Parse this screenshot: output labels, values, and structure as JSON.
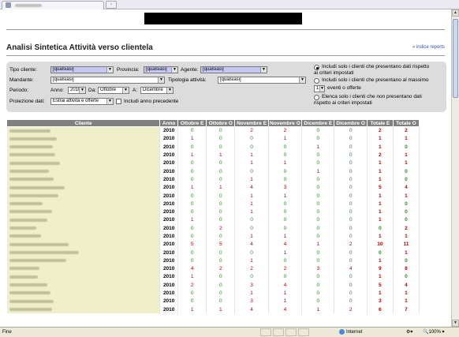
{
  "page": {
    "title": "Analisi Sintetica Attività verso clientela",
    "index_link": "« indice reports"
  },
  "filters": {
    "tipo_cliente_label": "Tipo cliente:",
    "tipo_cliente_value": "[qualsiasi]",
    "provincia_label": "Provincia:",
    "provincia_value": "[qualsiasi]",
    "agente_label": "Agente:",
    "agente_value": "[qualsiasi]",
    "mandante_label": "Mandante:",
    "mandante_value": "[qualsiasi]",
    "tipologia_label": "Tipologia attività:",
    "tipologia_value": "[qualsiasi]",
    "periodo_label": "Periodo:",
    "anno_label": "Anno:",
    "anno_value": "2010",
    "da_label": "Da:",
    "da_value": "Ottobre",
    "a_label": "A:",
    "a_value": "Dicembre",
    "proiezione_label": "Proiezione dati:",
    "proiezione_value": "Estrai attività e offerte",
    "includi_anno_label": "Includi anno precedente",
    "option1_line1": "Includi solo i clienti che presentano dati rispetto",
    "option1_line2": "ai criteri impostati",
    "option2_line1": "Includi solo i clienti che presentano al massimo",
    "option2_count": "1",
    "option2_line2": "eventi o offerte",
    "option3_line1": "Elenca solo i clienti che non presentano dati",
    "option3_line2": "rispetto ai criteri impostati"
  },
  "table": {
    "headers": [
      "Cliente",
      "Anno",
      "Ottobre E",
      "Ottobre O",
      "Novembre E",
      "Novembre O",
      "Dicembre E",
      "Dicembre O",
      "Totale E",
      "Totale O"
    ],
    "rows": [
      [
        "2010",
        "0",
        "0",
        "2",
        "2",
        "0",
        "0",
        "2",
        "2"
      ],
      [
        "2010",
        "1",
        "0",
        "0",
        "1",
        "0",
        "0",
        "1",
        "1"
      ],
      [
        "2010",
        "0",
        "0",
        "0",
        "0",
        "1",
        "0",
        "1",
        "0"
      ],
      [
        "2010",
        "1",
        "1",
        "1",
        "0",
        "0",
        "0",
        "2",
        "1"
      ],
      [
        "2010",
        "0",
        "0",
        "1",
        "1",
        "0",
        "0",
        "1",
        "1"
      ],
      [
        "2010",
        "0",
        "0",
        "0",
        "0",
        "1",
        "0",
        "1",
        "0"
      ],
      [
        "2010",
        "0",
        "0",
        "1",
        "0",
        "0",
        "0",
        "1",
        "0"
      ],
      [
        "2010",
        "1",
        "1",
        "4",
        "3",
        "0",
        "0",
        "5",
        "4"
      ],
      [
        "2010",
        "0",
        "0",
        "1",
        "1",
        "0",
        "0",
        "1",
        "1"
      ],
      [
        "2010",
        "0",
        "0",
        "1",
        "0",
        "0",
        "0",
        "1",
        "0"
      ],
      [
        "2010",
        "0",
        "0",
        "1",
        "0",
        "0",
        "0",
        "1",
        "0"
      ],
      [
        "2010",
        "1",
        "0",
        "0",
        "0",
        "0",
        "0",
        "1",
        "0"
      ],
      [
        "2010",
        "0",
        "2",
        "0",
        "0",
        "0",
        "0",
        "0",
        "2"
      ],
      [
        "2010",
        "0",
        "0",
        "1",
        "1",
        "0",
        "0",
        "1",
        "1"
      ],
      [
        "2010",
        "5",
        "5",
        "4",
        "4",
        "1",
        "2",
        "10",
        "11"
      ],
      [
        "2010",
        "0",
        "0",
        "0",
        "1",
        "0",
        "0",
        "0",
        "1"
      ],
      [
        "2010",
        "0",
        "0",
        "1",
        "0",
        "0",
        "0",
        "1",
        "0"
      ],
      [
        "2010",
        "4",
        "2",
        "2",
        "2",
        "3",
        "4",
        "9",
        "8"
      ],
      [
        "2010",
        "1",
        "0",
        "0",
        "0",
        "0",
        "0",
        "1",
        "0"
      ],
      [
        "2010",
        "2",
        "0",
        "3",
        "4",
        "0",
        "0",
        "5",
        "4"
      ],
      [
        "2010",
        "0",
        "0",
        "1",
        "1",
        "0",
        "0",
        "1",
        "1"
      ],
      [
        "2010",
        "0",
        "0",
        "3",
        "1",
        "0",
        "0",
        "3",
        "1"
      ],
      [
        "2010",
        "1",
        "1",
        "4",
        "4",
        "1",
        "2",
        "6",
        "7"
      ]
    ]
  },
  "statusbar": {
    "left": "Fine",
    "zone": "Internet",
    "zoom": "100%"
  },
  "colors": {
    "header_bg": "#808080",
    "cliente_bg": "#f0f0c8",
    "nonzero": "#c00000",
    "zero": "#2e8b2e",
    "highlight_select": "#c7c7f4"
  }
}
